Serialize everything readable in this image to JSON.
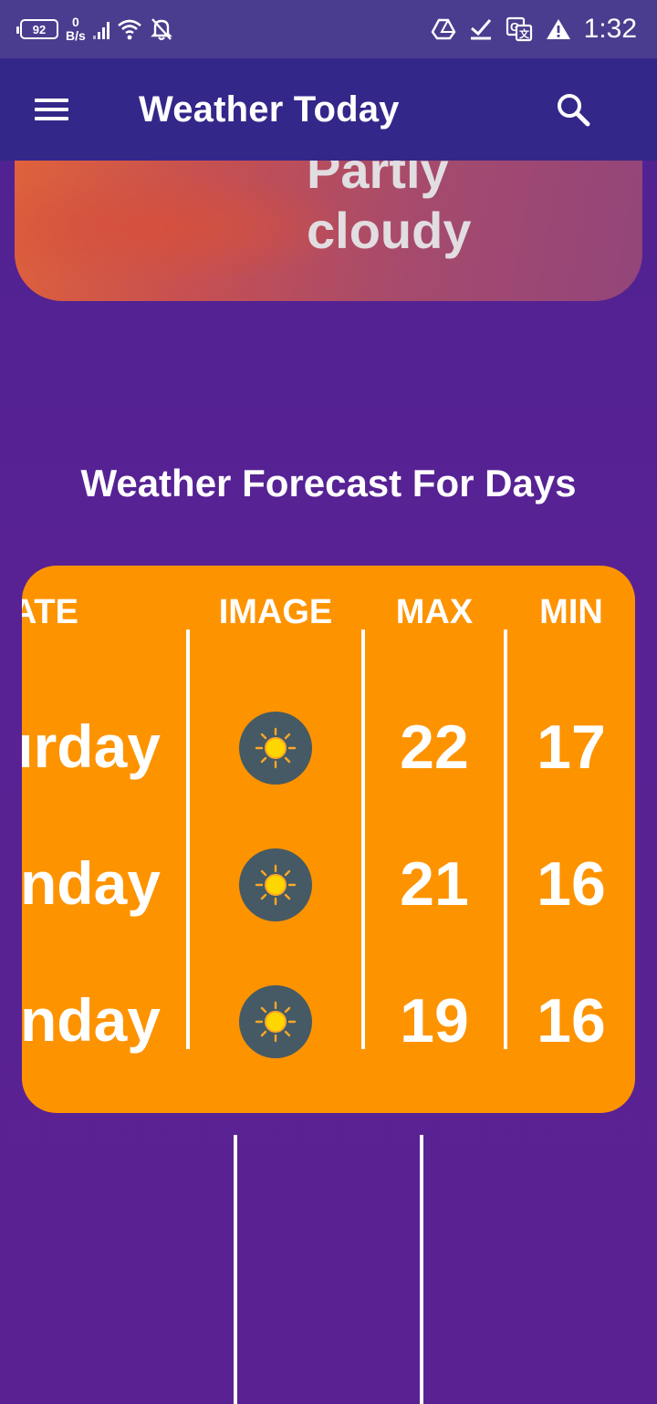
{
  "status_bar": {
    "battery": "92",
    "net_speed_value": "0",
    "net_speed_unit": "B/s",
    "time": "1:32",
    "icons": [
      "battery-icon",
      "signal-icon",
      "wifi-icon",
      "notifications-off-icon",
      "drive-icon",
      "check-icon",
      "translate-icon",
      "warning-icon"
    ]
  },
  "app_bar": {
    "title": "Weather Today",
    "menu_icon": "menu-icon",
    "search_icon": "search-icon"
  },
  "current": {
    "condition_line1": "Partly",
    "condition_line2": "cloudy"
  },
  "forecast": {
    "title": "Weather Forecast For Days",
    "headers": {
      "date": "ATE",
      "image": "IMAGE",
      "max": "MAX",
      "min": "MIN"
    },
    "rows": [
      {
        "day": "urday",
        "icon": "sun-icon",
        "max": "22",
        "min": "17"
      },
      {
        "day": "nday",
        "icon": "sun-icon",
        "max": "21",
        "min": "16"
      },
      {
        "day": "nday",
        "icon": "sun-icon",
        "max": "19",
        "min": "16"
      }
    ]
  },
  "colors": {
    "status_bar": "#4a3d8f",
    "app_bar": "#34278a",
    "background": "#582294",
    "forecast_card": "#fe9300",
    "icon_badge": "#455a64",
    "sun": "#ffd600"
  }
}
